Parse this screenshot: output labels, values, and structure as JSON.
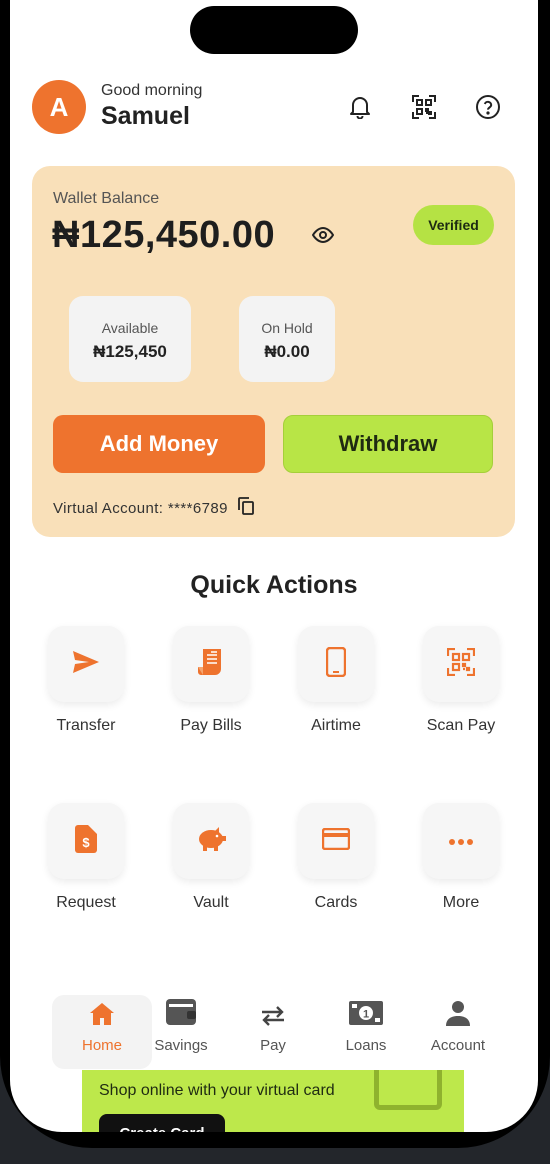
{
  "header": {
    "avatar_initial": "A",
    "greeting": "Good morning",
    "user_name": "Samuel",
    "icons": [
      "bell-icon",
      "qr-code-icon",
      "help-icon"
    ]
  },
  "wallet": {
    "label": "Wallet Balance",
    "balance": "₦125,450.00",
    "status": "Verified",
    "available_label": "Available",
    "available_value": "₦125,450",
    "on_hold_label": "On Hold",
    "on_hold_value": "₦0.00",
    "add_money": "Add Money",
    "withdraw": "Withdraw",
    "virtual_account": "Virtual Account: ****6789"
  },
  "quick_actions": {
    "title": "Quick Actions",
    "items": [
      {
        "label": "Transfer",
        "icon": "send-icon"
      },
      {
        "label": "Pay Bills",
        "icon": "receipt-icon"
      },
      {
        "label": "Airtime",
        "icon": "phone-icon"
      },
      {
        "label": "Scan Pay",
        "icon": "qr-scan-icon"
      },
      {
        "label": "Request",
        "icon": "dollar-document-icon"
      },
      {
        "label": "Vault",
        "icon": "piggy-bank-icon"
      },
      {
        "label": "Cards",
        "icon": "credit-card-icon"
      },
      {
        "label": "More",
        "icon": "more-icon"
      }
    ]
  },
  "promo": {
    "text": "Shop online with your virtual card",
    "button": "Create Card"
  },
  "nav": {
    "items": [
      {
        "label": "Home",
        "icon": "home-icon",
        "active": true
      },
      {
        "label": "Savings",
        "icon": "wallet-icon"
      },
      {
        "label": "Pay",
        "icon": "swap-arrows-icon"
      },
      {
        "label": "Loans",
        "icon": "cash-icon"
      },
      {
        "label": "Account",
        "icon": "person-icon"
      }
    ]
  },
  "colors": {
    "accent_orange": "#ee732e",
    "accent_green": "#b8e546",
    "wallet_bg": "#f9e0b9"
  }
}
